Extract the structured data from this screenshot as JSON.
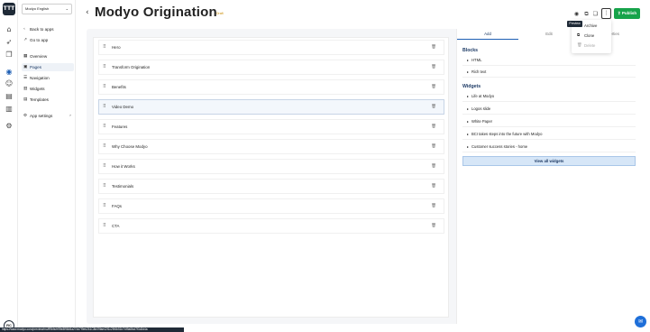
{
  "app": {
    "logo_text": "TTT"
  },
  "rail": {
    "icons": [
      "home-icon",
      "rocket-icon",
      "layers-icon",
      "globe-icon",
      "users-icon",
      "document-icon",
      "book-icon",
      "gear-icon"
    ],
    "avatar_initials": "RC"
  },
  "sidebar": {
    "org_select_value": "Modyo English",
    "back_to_apps": "Back to apps",
    "go_to_app": "Go to app",
    "items": [
      {
        "label": "Overview",
        "icon": "overview-icon"
      },
      {
        "label": "Pages",
        "icon": "pages-icon",
        "active": true
      },
      {
        "label": "Navigation",
        "icon": "navigation-icon"
      },
      {
        "label": "Widgets",
        "icon": "widgets-icon"
      },
      {
        "label": "Templates",
        "icon": "templates-icon"
      }
    ],
    "app_settings": "App settings"
  },
  "header": {
    "title": "Modyo Origination",
    "status_badge": "Draft",
    "tooltip": "Preview",
    "publish_label": "Publish"
  },
  "menu": {
    "items": [
      {
        "label": "Archive",
        "disabled": false
      },
      {
        "label": "Clone",
        "disabled": false
      },
      {
        "label": "Delete",
        "disabled": true
      }
    ]
  },
  "blocks": [
    {
      "label": "Hero"
    },
    {
      "label": "Transform Origination"
    },
    {
      "label": "Benefits"
    },
    {
      "label": "Video Demo",
      "selected": true
    },
    {
      "label": "Features"
    },
    {
      "label": "Why Choose Modyo"
    },
    {
      "label": "How it Works"
    },
    {
      "label": "Testimonials"
    },
    {
      "label": "FAQs"
    },
    {
      "label": "CTA"
    }
  ],
  "panel": {
    "tabs": [
      "Add",
      "Edit",
      "Properties"
    ],
    "active_tab": "Add",
    "blocks_heading": "Blocks",
    "block_items": [
      "HTML",
      "Rich text"
    ],
    "widgets_heading": "Widgets",
    "widget_items": [
      "Life at Modyo",
      "Logos slide",
      "White Paper",
      "BCI takes steps into the future with Modyo",
      "Customer success stories - home"
    ],
    "view_all_label": "View all widgets"
  },
  "statusbar": {
    "url": "https://www.modyo.com/preview/mc/ff9bfe/e99e8f96b5a274d7f9eb261C8b09fae42f1c29f4b51b74f9a6fcd7f3d2d4a"
  },
  "colors": {
    "accent": "#1e5fb4",
    "publish": "#16a34a",
    "dark": "#1f2a37",
    "draft": "#c98a00"
  }
}
